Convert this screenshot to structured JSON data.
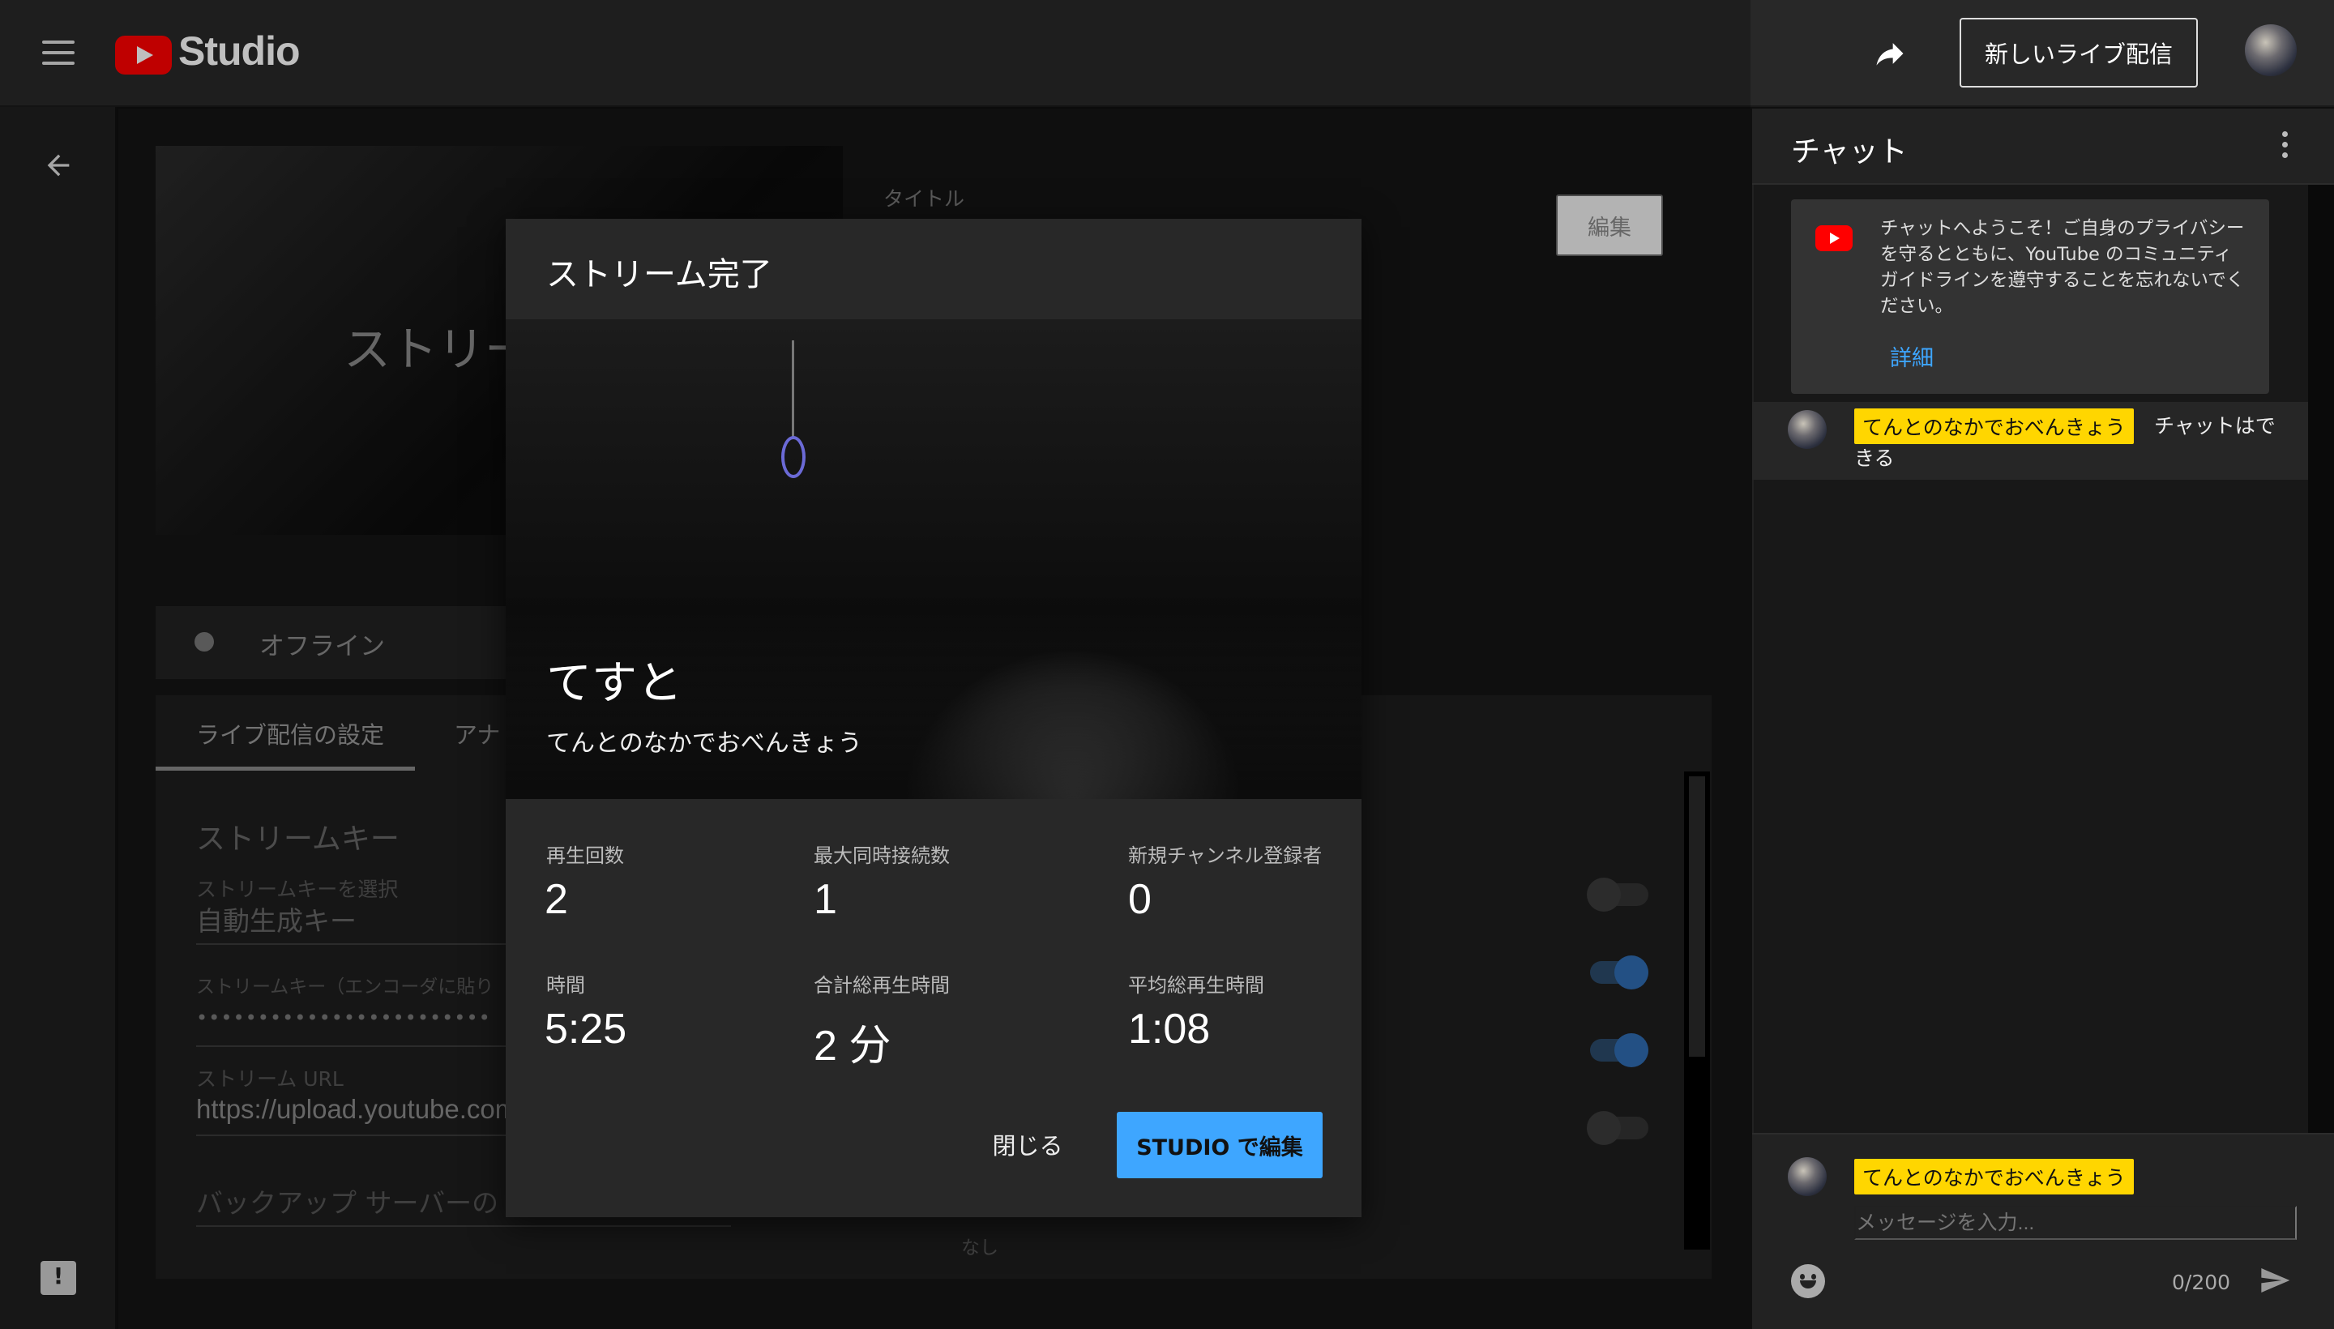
{
  "app": {
    "logo_text": "Studio",
    "new_live_button": "新しいライブ配信"
  },
  "background": {
    "preview_text": "ストリー",
    "title_label": "タイトル",
    "edit_button": "編集",
    "status_text": "オフライン",
    "tabs": [
      "ライブ配信の設定",
      "アナ"
    ],
    "stream_key_title": "ストリームキー",
    "stream_key_select_label": "ストリームキーを選択",
    "stream_key_select_value": "自動生成キー",
    "stream_key_label": "ストリームキー（エンコーダに貼り",
    "stream_key_masked": "••••••••••••••••••••••••",
    "stream_url_label": "ストリーム URL",
    "stream_url_value": "https://upload.youtube.com",
    "backup_server_label": "バックアップ サーバーの U",
    "below_dialog_label": "なし"
  },
  "dialog": {
    "title": "ストリーム完了",
    "video_title": "てすと",
    "channel_name": "てんとのなかでおべんきょう",
    "stats": [
      {
        "label": "再生回数",
        "value": "2"
      },
      {
        "label": "最大同時接続数",
        "value": "1"
      },
      {
        "label": "新規チャンネル登録者",
        "value": "0"
      },
      {
        "label": "時間",
        "value": "5:25"
      },
      {
        "label": "合計総再生時間",
        "value": "2 分"
      },
      {
        "label": "平均総再生時間",
        "value": "1:08"
      }
    ],
    "close_button": "閉じる",
    "studio_button": "STUDIO で編集"
  },
  "chat": {
    "title": "チャット",
    "welcome_text": "チャットへようこそ！ご自身のプライバシーを守るとともに、YouTube のコミュニティ ガイドラインを遵守することを忘れないでください。",
    "welcome_link": "詳細",
    "messages": [
      {
        "author": "てんとのなかでおべんきょう",
        "text": "チャットはできる"
      }
    ],
    "input_author": "てんとのなかでおべんきょう",
    "input_placeholder": "メッセージを入力...",
    "char_count": "0/200"
  },
  "colors": {
    "accent": "#3ea6ff",
    "brand_red": "#ff0000",
    "author_highlight": "#ffd600"
  },
  "toggles": [
    {
      "state": "off"
    },
    {
      "state": "on"
    },
    {
      "state": "on"
    },
    {
      "state": "off"
    }
  ]
}
